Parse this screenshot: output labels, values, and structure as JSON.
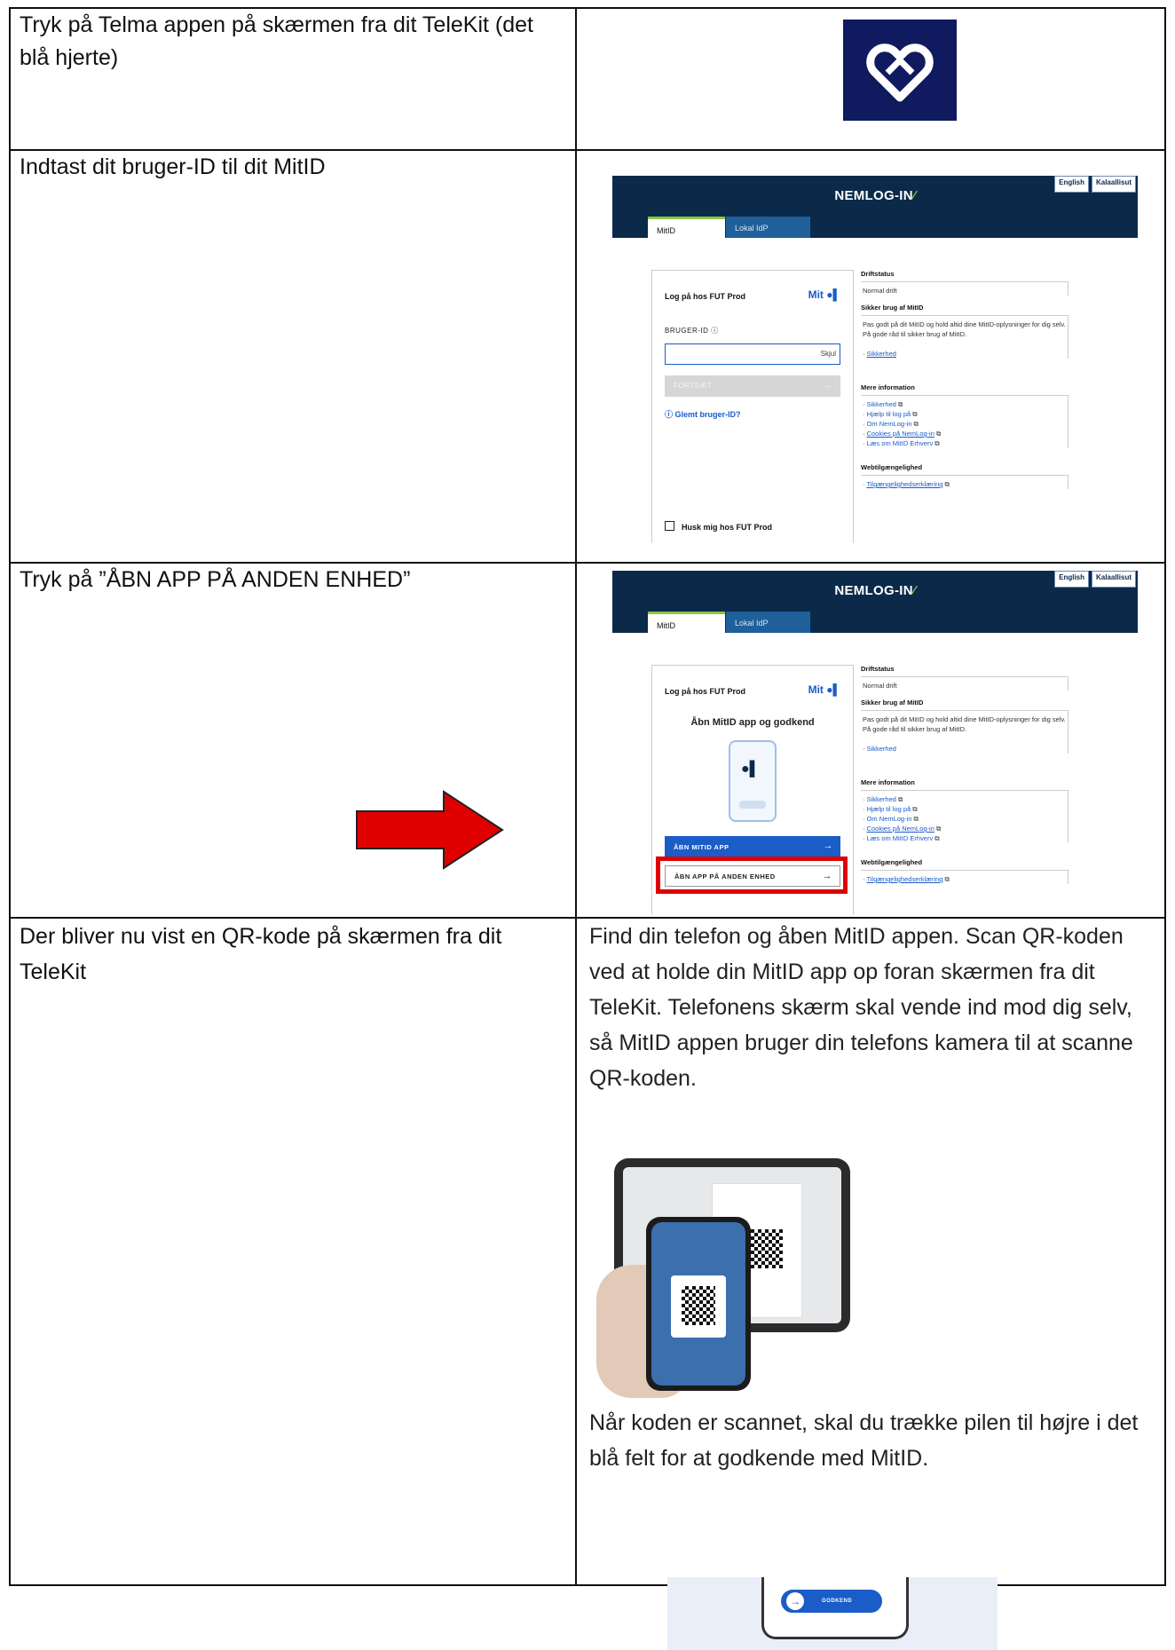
{
  "rows": [
    {
      "instruction": "Tryk på Telma appen på skærmen fra dit TeleKit (det blå hjerte)"
    },
    {
      "instruction": "Indtast dit bruger-ID til dit MitID"
    },
    {
      "instruction": "Tryk på ”ÅBN APP PÅ ANDEN ENHED”"
    },
    {
      "instruction": "Der bliver nu vist en QR-kode på skærmen fra dit TeleKit"
    }
  ],
  "nemlog": {
    "title": "NEMLOG-IN",
    "lang_english": "English",
    "lang_kalaallisut": "Kalaallisut",
    "tab_mitid": "MitID",
    "tab_lokal": "Lokal IdP",
    "login_header": "Log på hos FUT Prod",
    "brand": "Mit",
    "user_label": "BRUGER-ID  ⓘ",
    "hide": "Skjul",
    "continue": "FORTSÆT",
    "forgot": "Glemt bruger-ID?",
    "remember": "Husk mig hos FUT Prod",
    "open_heading": "Åbn MitID app og godkend",
    "open_app": "ÅBN MITID APP",
    "open_other": "ÅBN APP PÅ ANDEN ENHED",
    "drift_head": "Driftstatus",
    "drift_body": "Normal drift",
    "safe_head": "Sikker brug af MitID",
    "safe_body": "Pas godt på dit MitID og hold altid dine MitID-oplysninger for dig selv. På gode råd til sikker brug af MitID.",
    "safe_link": "Sikkerhed",
    "more_head": "Mere information",
    "more_links": [
      "Sikkerhed",
      "Hjælp til log på",
      "Om NemLog-in",
      "Cookies på NemLog-in",
      "Læs om MitID Erhverv"
    ],
    "web_head": "Webtilgængelighed",
    "web_link": "Tilgængelighedserklæring"
  },
  "step4": {
    "text1": "Find din telefon og åben MitID appen. Scan QR-koden ved at holde din MitID app op foran skærmen fra dit TeleKit. Telefonens skærm skal vende ind mod dig selv, så MitID appen bruger din telefons kamera til at scanne QR-koden.",
    "text2": "Når koden er scannet, skal du trække pilen til højre i det blå felt for at godkende med MitID.",
    "approve": "GODKEND"
  },
  "colors": {
    "nemlog_blue": "#0b2a4a",
    "mitid_blue": "#1a5cc8",
    "telma_navy": "#101a5e",
    "highlight_red": "#e00000"
  }
}
